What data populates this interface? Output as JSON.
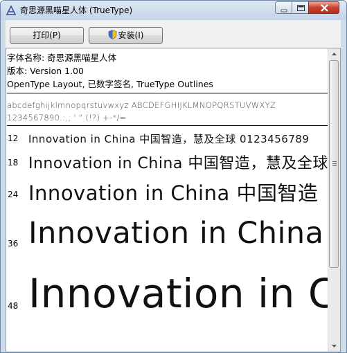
{
  "window": {
    "title": "奇思源黑喵星人体 (TrueType)"
  },
  "toolbar": {
    "print_label": "打印(P)",
    "install_label": "安装(I)"
  },
  "info": {
    "font_name_line": "字体名称: 奇思源黑喵星人体",
    "version_line": "版本: Version 1.00",
    "layout_line": "OpenType Layout, 已数字签名, TrueType Outlines"
  },
  "charset": {
    "line1": "abcdefghijklmnopqrstuvwxyz ABCDEFGHIJKLMNOPQRSTUVWXYZ",
    "line2": "1234567890.:,; ' \" (!?) +-*/="
  },
  "samples": [
    {
      "size": "12",
      "text": "Innovation in China 中国智造，慧及全球 0123456789"
    },
    {
      "size": "18",
      "text": "Innovation in China 中国智造，慧及全球"
    },
    {
      "size": "24",
      "text": "Innovation in China 中国智造"
    },
    {
      "size": "36",
      "text": "Innovation in China"
    },
    {
      "size": "48",
      "text": "Innovation in C"
    }
  ]
}
